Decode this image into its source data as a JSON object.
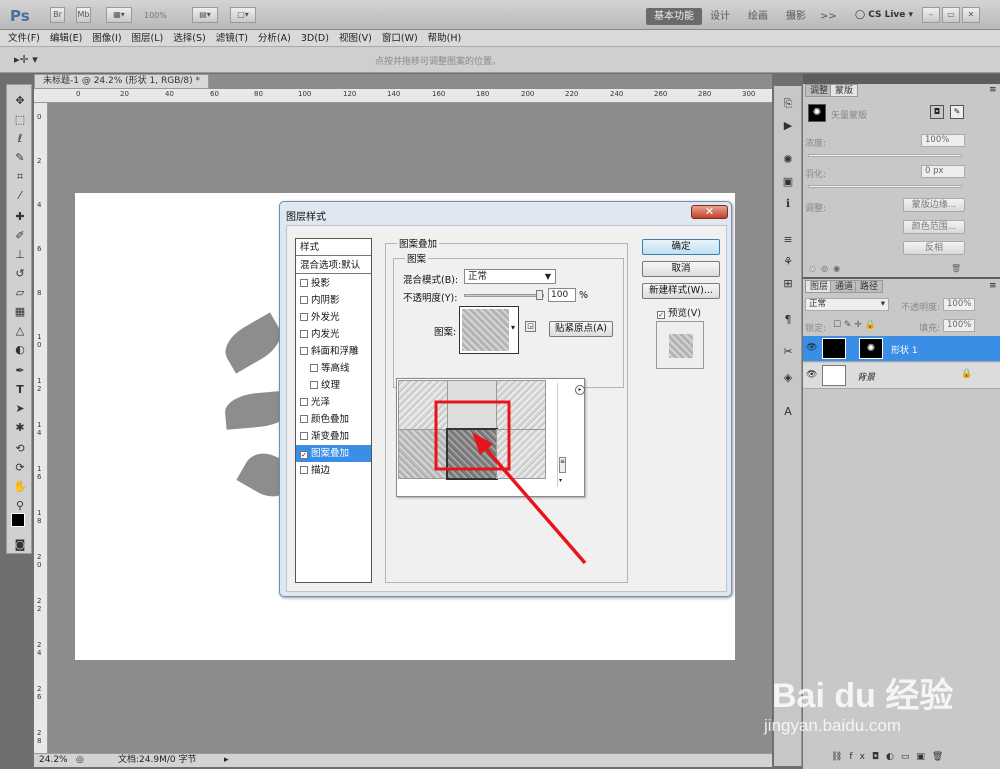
{
  "app": {
    "logo": "Ps",
    "zoom_field": "100%",
    "workspace_buttons": [
      "基本功能",
      "设计",
      "绘画",
      "摄影",
      ">>"
    ],
    "cslive": "CS Live"
  },
  "menu": [
    "文件(F)",
    "编辑(E)",
    "图像(I)",
    "图层(L)",
    "选择(S)",
    "滤镜(T)",
    "分析(A)",
    "3D(D)",
    "视图(V)",
    "窗口(W)",
    "帮助(H)"
  ],
  "options_hint": "点按并拖移可调整图案的位置。",
  "document": {
    "tab": "未标题-1 @ 24.2% (形状 1, RGB/8) *",
    "ruler_h": [
      "0",
      "20",
      "40",
      "60",
      "80",
      "100",
      "120",
      "140",
      "160",
      "180",
      "200",
      "220",
      "240",
      "260",
      "280",
      "300"
    ],
    "ruler_v": [
      "0",
      "2",
      "4",
      "6",
      "8",
      "1 0",
      "1 2",
      "1 4",
      "1 6",
      "1 8",
      "2 0",
      "2 2",
      "2 4",
      "2 6",
      "2 8"
    ],
    "zoom": "24.2%",
    "doc_info": "文档:24.9M/0 字节"
  },
  "dialog": {
    "title": "图层样式",
    "close": "✕",
    "styles_header": "样式",
    "blend_options": "混合选项:默认",
    "effects": [
      {
        "label": "投影",
        "checked": false,
        "indent": false
      },
      {
        "label": "内阴影",
        "checked": false,
        "indent": false
      },
      {
        "label": "外发光",
        "checked": false,
        "indent": false
      },
      {
        "label": "内发光",
        "checked": false,
        "indent": false
      },
      {
        "label": "斜面和浮雕",
        "checked": false,
        "indent": false
      },
      {
        "label": "等高线",
        "checked": false,
        "indent": true
      },
      {
        "label": "纹理",
        "checked": false,
        "indent": true
      },
      {
        "label": "光泽",
        "checked": false,
        "indent": false
      },
      {
        "label": "颜色叠加",
        "checked": false,
        "indent": false
      },
      {
        "label": "渐变叠加",
        "checked": false,
        "indent": false
      },
      {
        "label": "图案叠加",
        "checked": true,
        "indent": false,
        "selected": true
      },
      {
        "label": "描边",
        "checked": false,
        "indent": false
      }
    ],
    "section_title": "图案叠加",
    "group_title": "图案",
    "blend_mode_label": "混合模式(B):",
    "blend_mode_value": "正常",
    "opacity_label": "不透明度(Y):",
    "opacity_value": "100",
    "opacity_unit": "%",
    "opacity_level": 1.0,
    "pattern_label": "图案:",
    "snap_button": "贴紧原点(A)",
    "ok": "确定",
    "cancel": "取消",
    "new_style": "新建样式(W)...",
    "preview_label": "预览(V)",
    "preview_checked": true
  },
  "right_panel": {
    "tabs_top": [
      "调整",
      "蒙版"
    ],
    "mask_title": "矢量蒙版",
    "density_label": "浓度:",
    "density_value": "100%",
    "feather_label": "羽化:",
    "feather_value": "0 px",
    "refine_label": "调整:",
    "refine_buttons": [
      "蒙版边缘...",
      "颜色范围...",
      "反相"
    ],
    "tabs_layers": [
      "图层",
      "通道",
      "路径"
    ],
    "blend_mode": "正常",
    "opacity_label": "不透明度:",
    "opacity_value": "100%",
    "lock_label": "锁定:",
    "fill_label": "填充:",
    "fill_value": "100%",
    "layers": [
      {
        "name": "形状 1",
        "selected": true
      },
      {
        "name": "背景",
        "selected": false,
        "locked": true
      }
    ]
  },
  "watermark": {
    "brand": "Bai du 经验",
    "url": "jingyan.baidu.com"
  },
  "colors": {
    "selection_blue": "#3a8ee6",
    "annotation_red": "#e8141c"
  }
}
